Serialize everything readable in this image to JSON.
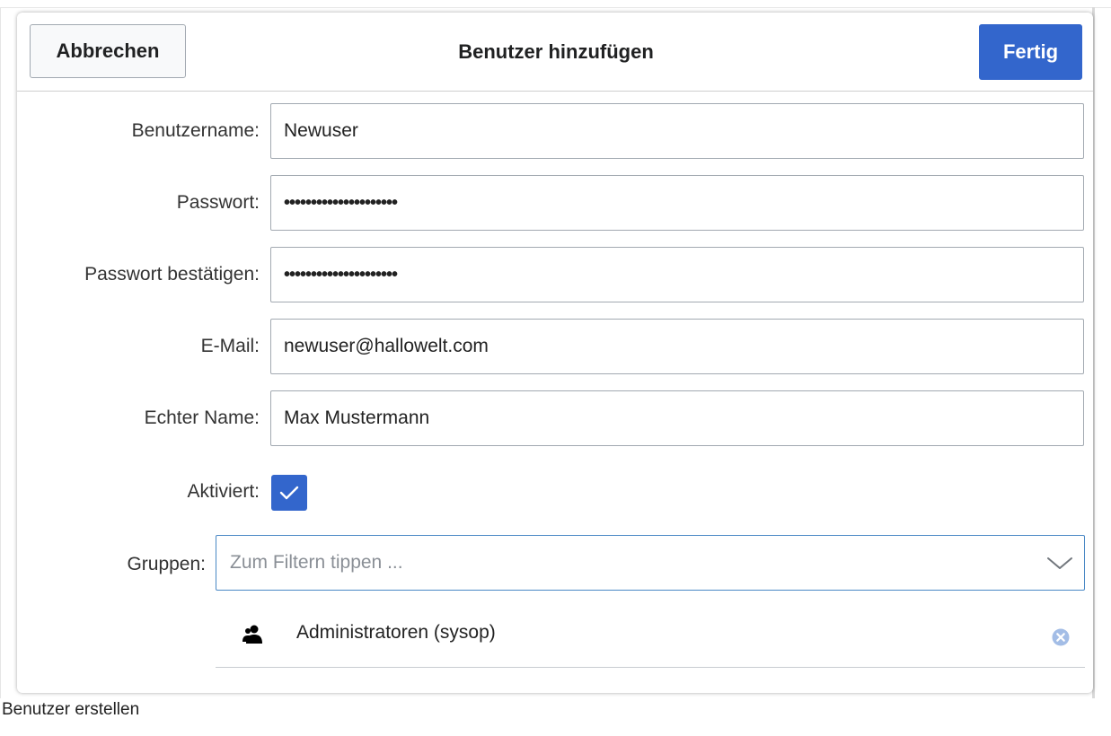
{
  "dialog": {
    "title": "Benutzer hinzufügen",
    "cancel_label": "Abbrechen",
    "done_label": "Fertig"
  },
  "form": {
    "username": {
      "label": "Benutzername:",
      "value": "Newuser"
    },
    "password": {
      "label": "Passwort:",
      "value": "•••••••••••••••••••••"
    },
    "password_confirm": {
      "label": "Passwort bestätigen:",
      "value": "•••••••••••••••••••••"
    },
    "email": {
      "label": "E-Mail:",
      "value": "newuser@hallowelt.com"
    },
    "real_name": {
      "label": "Echter Name:",
      "value": "Max Mustermann"
    },
    "enabled": {
      "label": "Aktiviert:",
      "checked": true
    },
    "groups": {
      "label": "Gruppen:",
      "placeholder": "Zum Filtern tippen ...",
      "selected": [
        {
          "label": "Administratoren (sysop)",
          "icon": "user-group-icon"
        }
      ]
    }
  },
  "caption": "Benutzer erstellen",
  "colors": {
    "accent": "#3366cc",
    "focus_border": "#4a88c5",
    "border": "#a2a9b1"
  }
}
